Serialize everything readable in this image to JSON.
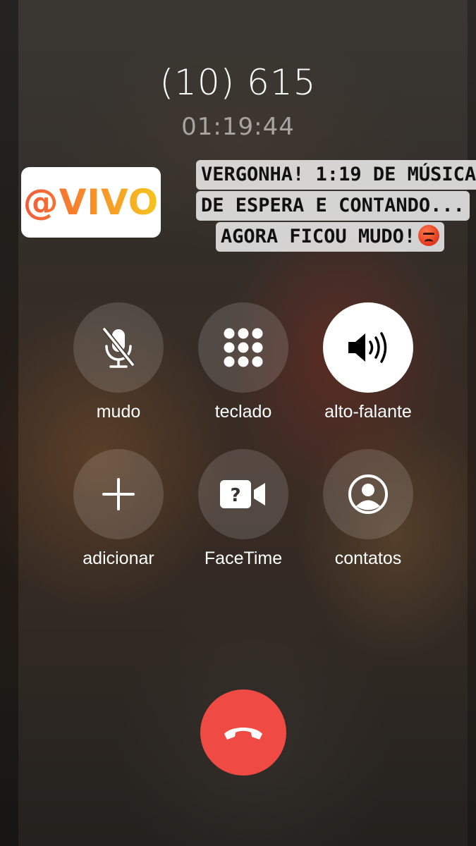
{
  "call": {
    "caller": "(10) 615",
    "duration": "01:19:44"
  },
  "stickers": {
    "brand": "@VIVO",
    "caption_lines": [
      "VERGONHA! 1:19 DE MÚSICA",
      "DE ESPERA E CONTANDO...",
      "AGORA FICOU MUDO!"
    ],
    "caption_emoji": "angry-face-emoji"
  },
  "controls": [
    {
      "id": "mute",
      "label": "mudo",
      "icon": "mic-off-icon",
      "active": false
    },
    {
      "id": "keypad",
      "label": "teclado",
      "icon": "keypad-icon",
      "active": false
    },
    {
      "id": "speaker",
      "label": "alto-falante",
      "icon": "speaker-icon",
      "active": true
    },
    {
      "id": "add",
      "label": "adicionar",
      "icon": "plus-icon",
      "active": false
    },
    {
      "id": "facetime",
      "label": "FaceTime",
      "icon": "facetime-unavailable-icon",
      "active": false
    },
    {
      "id": "contacts",
      "label": "contatos",
      "icon": "contact-icon",
      "active": false
    }
  ],
  "end_call": {
    "icon": "hang-up-icon",
    "color": "#ef4a43"
  },
  "colors": {
    "button_bg": "rgba(255,255,255,0.14)",
    "active_button_bg": "#ffffff",
    "brand_gradient": [
      "#f3583a",
      "#f7892c",
      "#f5c51d"
    ]
  }
}
